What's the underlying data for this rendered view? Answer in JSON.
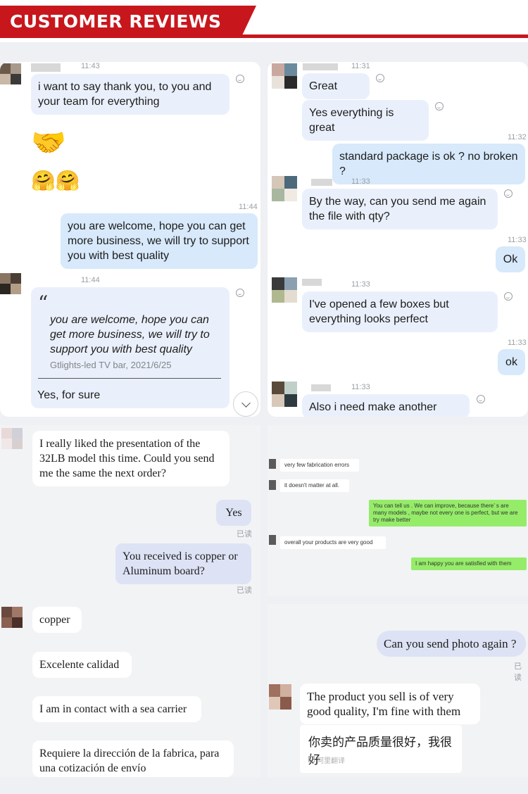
{
  "header": {
    "title": "CUSTOMER REVIEWS"
  },
  "panel1": {
    "t1": "11:43",
    "msg1": "i want to say thank you, to you and your team for everything",
    "emoji1": "🤝",
    "emoji2": "🤗🤗",
    "t2": "11:44",
    "msg2": "you are welcome, hope you can get more business, we will try to support you with best quality",
    "t3": "11:44",
    "quote_mark": "“",
    "quote_text": "you are welcome, hope you can get more business, we will try to support you with best quality",
    "quote_src": "Gtlights-led TV bar, 2021/6/25",
    "reply": "Yes, for sure"
  },
  "panel2": {
    "t1": "11:31",
    "msg1": "Great",
    "msg2": "Yes everything is great",
    "t2": "11:32",
    "msg3": "standard package is ok ? no broken ?",
    "t3": "11:33",
    "msg4": "By the way, can you send me again the file with qty?",
    "t4": "11:33",
    "msg5": "Ok",
    "t5": "11:33",
    "msg6": "I've opened a few boxes but everything looks perfect",
    "t6": "11:33",
    "msg7": "ok",
    "t7": "11:33",
    "msg8": "Also i need make another order"
  },
  "panel3": {
    "msg1": "I really liked the presentation of the 32LB model this time. Could you send me the same the next order?",
    "msg2": "Yes",
    "read1": "已读",
    "msg3": "You received is copper or Aluminum board?",
    "read2": "已读",
    "msg4": "copper",
    "msg5": "Excelente calidad",
    "msg6": "I am in contact with a sea carrier",
    "msg7": "Requiere la dirección de la fabrica, para una cotización de envío"
  },
  "panel4": {
    "msg1": "very few fabrication errors",
    "msg2": "it doesn't matter at all.",
    "msg3": "You can tell us . We can improve, because there’ s are many models , maybe not every one is perfect, but we are try make better",
    "msg4": "overall your products are very good",
    "msg5": "I am happy you are satisfied with them"
  },
  "panel5": {
    "msg1": "Can you send photo again ?",
    "read": "已读",
    "msg2": "The product you sell is of very good quality, I'm fine with them",
    "msg3": "你卖的产品质量很好，我很好",
    "translate": "阿里翻译"
  },
  "colors": {
    "accent": "#c8161d",
    "bubble": "#eaf0fb",
    "bubble_self": "#d7e9fb",
    "wechat_green": "#95ec69"
  }
}
